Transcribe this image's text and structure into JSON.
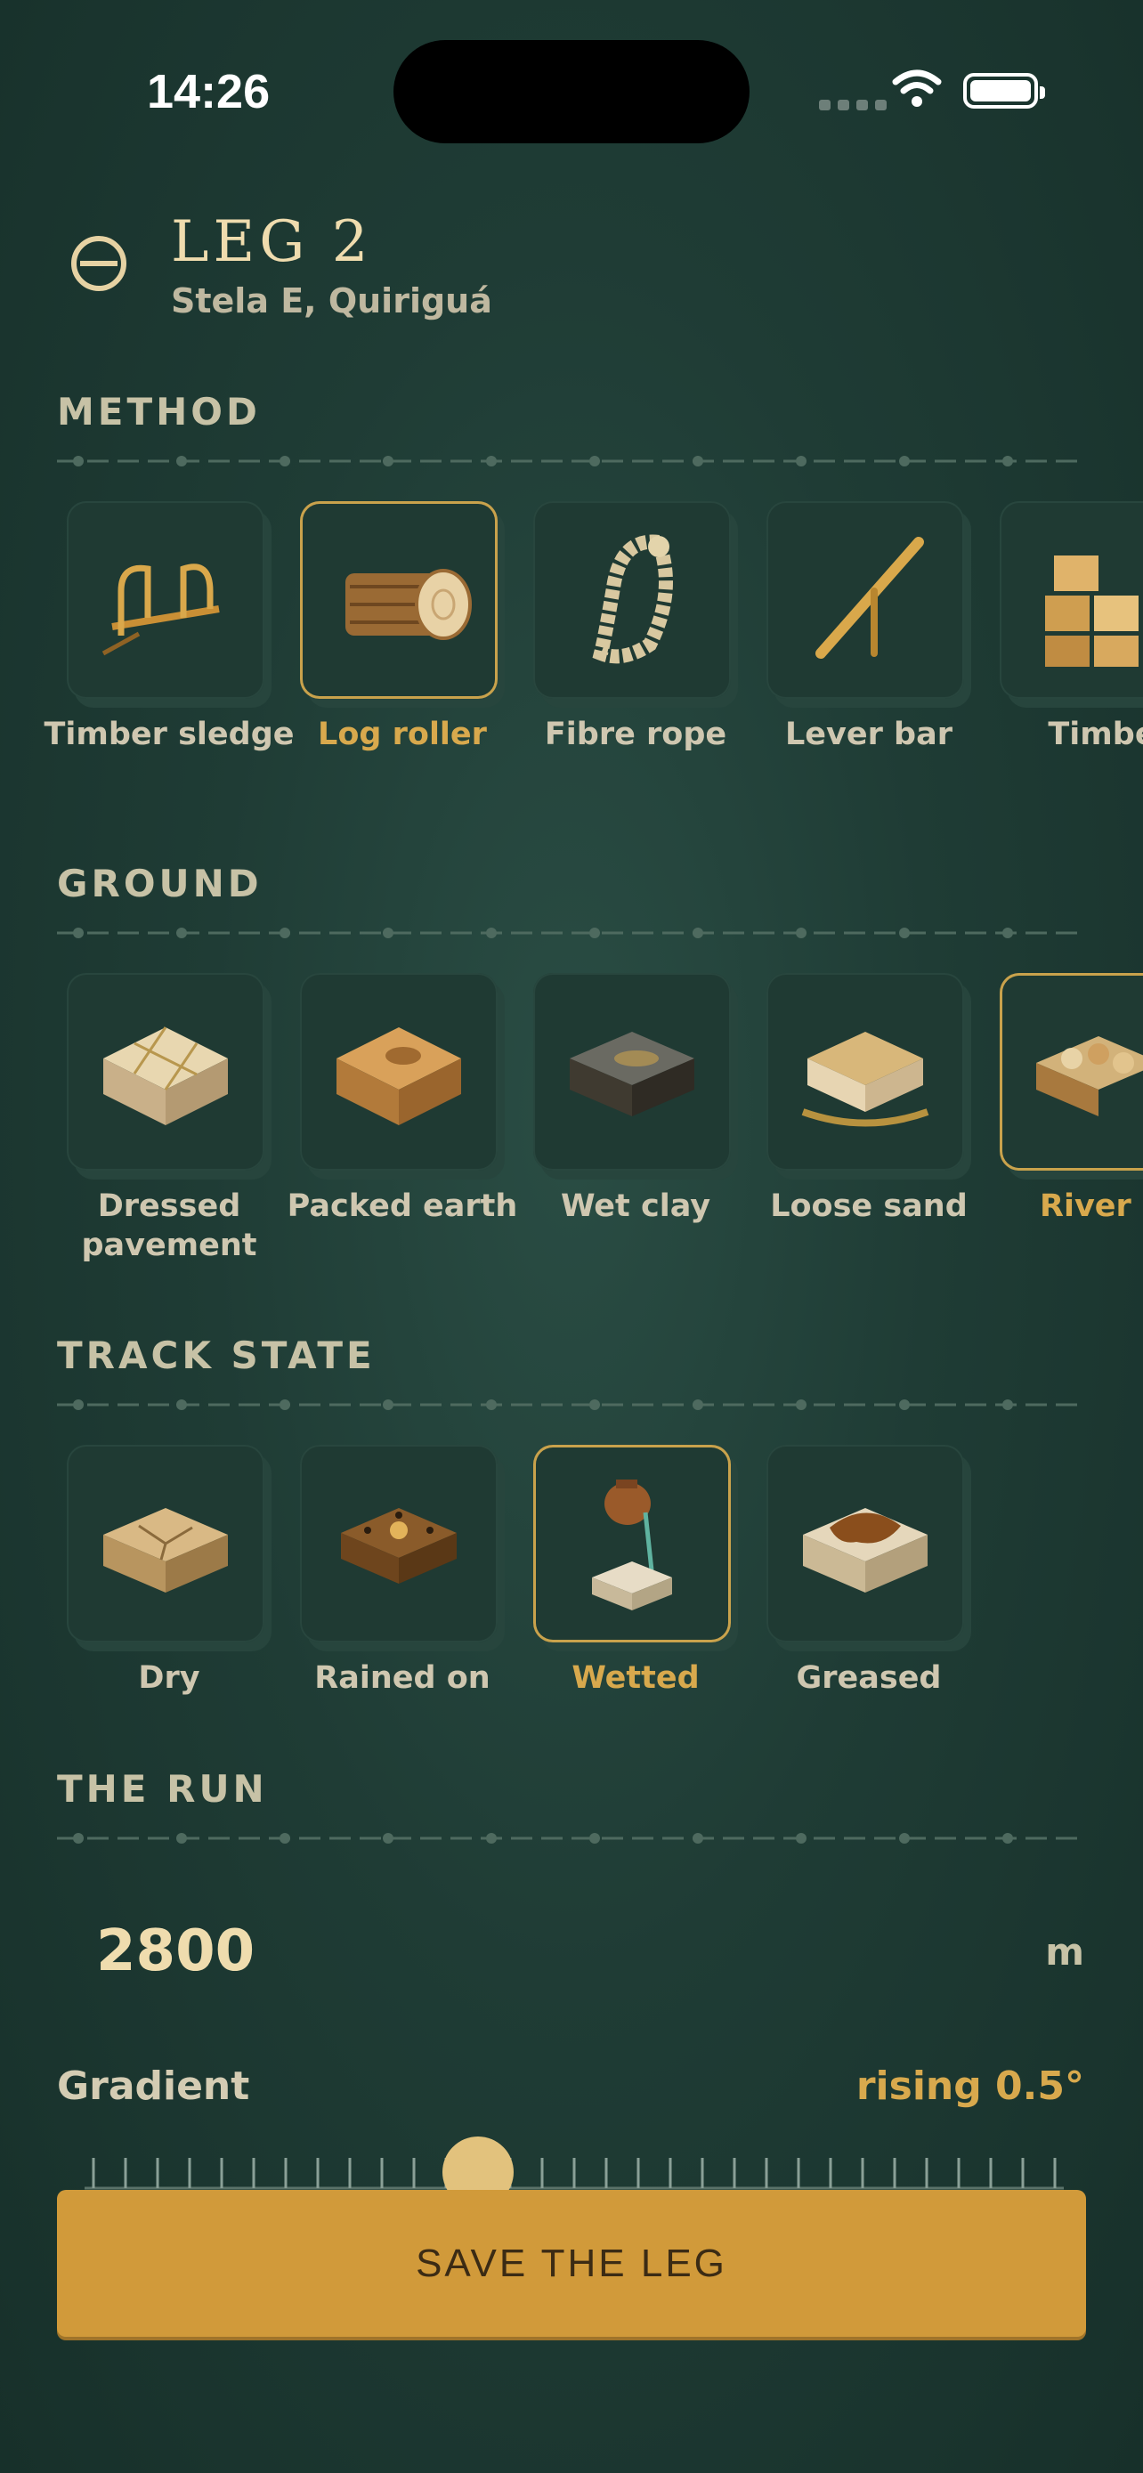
{
  "status_bar": {
    "time": "14:26"
  },
  "header": {
    "title": "LEG 2",
    "subtitle": "Stela E, Quiriguá",
    "icon": "collapse-circle-icon"
  },
  "sections": {
    "method": {
      "title": "METHOD",
      "items": [
        {
          "label": "Timber sledge",
          "icon": "sledge-icon",
          "selected": false
        },
        {
          "label": "Log roller",
          "icon": "log-icon",
          "selected": true
        },
        {
          "label": "Fibre rope",
          "icon": "rope-icon",
          "selected": false
        },
        {
          "label": "Lever bar",
          "icon": "lever-icon",
          "selected": false
        },
        {
          "label": "Timbe",
          "icon": "timber-blocks-icon",
          "selected": false
        }
      ]
    },
    "ground": {
      "title": "GROUND",
      "items": [
        {
          "label": "Dressed pavement",
          "icon": "pavement-icon",
          "selected": false
        },
        {
          "label": "Packed earth",
          "icon": "earth-icon",
          "selected": false
        },
        {
          "label": "Wet clay",
          "icon": "clay-icon",
          "selected": false
        },
        {
          "label": "Loose sand",
          "icon": "sand-icon",
          "selected": false
        },
        {
          "label": "River g",
          "icon": "river-gravel-icon",
          "selected": true
        }
      ]
    },
    "track_state": {
      "title": "TRACK STATE",
      "items": [
        {
          "label": "Dry",
          "icon": "dry-block-icon",
          "selected": false
        },
        {
          "label": "Rained on",
          "icon": "rained-block-icon",
          "selected": false
        },
        {
          "label": "Wetted",
          "icon": "water-jug-icon",
          "selected": true
        },
        {
          "label": "Greased",
          "icon": "greased-block-icon",
          "selected": false
        }
      ]
    },
    "run": {
      "title": "THE RUN",
      "distance_value": "2800",
      "distance_unit": "m",
      "gradient_label": "Gradient",
      "gradient_value": "rising 0.5°",
      "gradient_slider_fraction": 0.52
    }
  },
  "save_button": {
    "label": "SAVE THE LEG"
  },
  "colors": {
    "accent": "#d19a3a",
    "selected_text": "#d8a94d",
    "background": "#1f3c35"
  }
}
